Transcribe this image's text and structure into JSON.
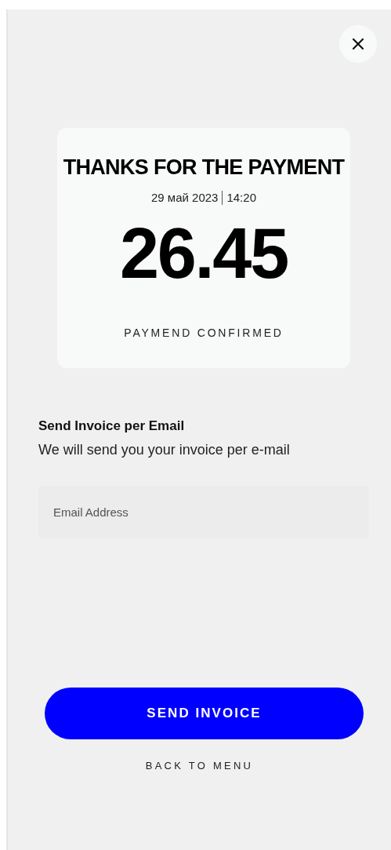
{
  "receipt": {
    "title": "THANKS FOR THE PAYMENT",
    "date": "29 май 2023",
    "time": "14:20",
    "amount": "26.45",
    "status": "PAYMEND CONFIRMED"
  },
  "invoice": {
    "heading": "Send Invoice per Email",
    "description": "We will send you your invoice per e-mail",
    "email_field": {
      "placeholder": "Email Address"
    }
  },
  "buttons": {
    "primary": "SEND INVOICE",
    "secondary": "BACK TO MENU"
  }
}
